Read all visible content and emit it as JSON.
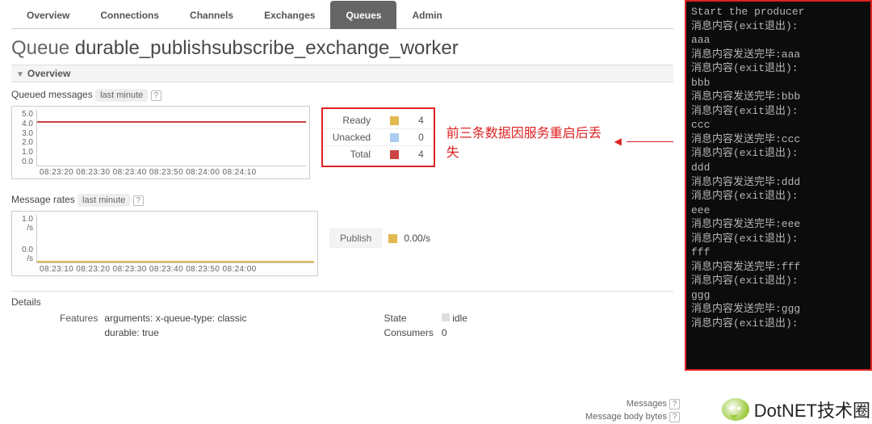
{
  "tabs": {
    "overview": "Overview",
    "connections": "Connections",
    "channels": "Channels",
    "exchanges": "Exchanges",
    "queues": "Queues",
    "admin": "Admin"
  },
  "page_title_prefix": "Queue ",
  "queue_name": "durable_publishsubscribe_exchange_worker",
  "section_overview": "Overview",
  "queued_messages": {
    "label": "Queued messages",
    "range": "last minute",
    "help": "?"
  },
  "legend": {
    "ready": {
      "label": "Ready",
      "value": "4"
    },
    "unacked": {
      "label": "Unacked",
      "value": "0"
    },
    "total": {
      "label": "Total",
      "value": "4"
    }
  },
  "annotation": "前三条数据因服务重启后丢失",
  "message_rates": {
    "label": "Message rates",
    "range": "last minute",
    "help": "?",
    "publish_label": "Publish",
    "publish_rate": "0.00/s"
  },
  "section_details": "Details",
  "details": {
    "features_label": "Features",
    "arguments_label": "arguments:",
    "arguments_key": "x-queue-type:",
    "arguments_val": "classic",
    "durable_label": "durable:",
    "durable_val": "true",
    "state_label": "State",
    "state_val": "idle",
    "consumers_label": "Consumers",
    "consumers_val": "0",
    "messages_label": "Messages",
    "messages_help": "?",
    "mbb_label": "Message body bytes",
    "mbb_help": "?"
  },
  "terminal_lines": [
    "Start the producer",
    "消息内容(exit退出):",
    "aaa",
    "消息内容发送完毕:aaa",
    "消息内容(exit退出):",
    "bbb",
    "消息内容发送完毕:bbb",
    "消息内容(exit退出):",
    "ccc",
    "消息内容发送完毕:ccc",
    "消息内容(exit退出):",
    "ddd",
    "消息内容发送完毕:ddd",
    "消息内容(exit退出):",
    "eee",
    "消息内容发送完毕:eee",
    "消息内容(exit退出):",
    "fff",
    "消息内容发送完毕:fff",
    "消息内容(exit退出):",
    "ggg",
    "消息内容发送完毕:ggg",
    "消息内容(exit退出):"
  ],
  "watermark": "DotNET技术圈",
  "chart_data": [
    {
      "type": "line",
      "title": "Queued messages (last minute)",
      "x": [
        "08:23:20",
        "08:23:30",
        "08:23:40",
        "08:23:50",
        "08:24:00",
        "08:24:10"
      ],
      "series": [
        {
          "name": "Ready",
          "color": "#e0b94f",
          "approx_constant_value": 4
        },
        {
          "name": "Unacked",
          "color": "#aaccee",
          "approx_constant_value": 0
        },
        {
          "name": "Total",
          "color": "#c44",
          "approx_constant_value": 4
        }
      ],
      "yticks": [
        0.0,
        1.0,
        2.0,
        3.0,
        4.0,
        5.0
      ],
      "ylim": [
        0,
        5
      ]
    },
    {
      "type": "line",
      "title": "Message rates (last minute)",
      "x": [
        "08:23:10",
        "08:23:20",
        "08:23:30",
        "08:23:40",
        "08:23:50",
        "08:24:00"
      ],
      "series": [
        {
          "name": "Publish",
          "color": "#e0b94f",
          "approx_constant_value": 0.0,
          "unit": "/s"
        }
      ],
      "yticks_label": [
        "0.0 /s",
        "1.0 /s"
      ],
      "ylim": [
        0,
        1
      ]
    }
  ]
}
